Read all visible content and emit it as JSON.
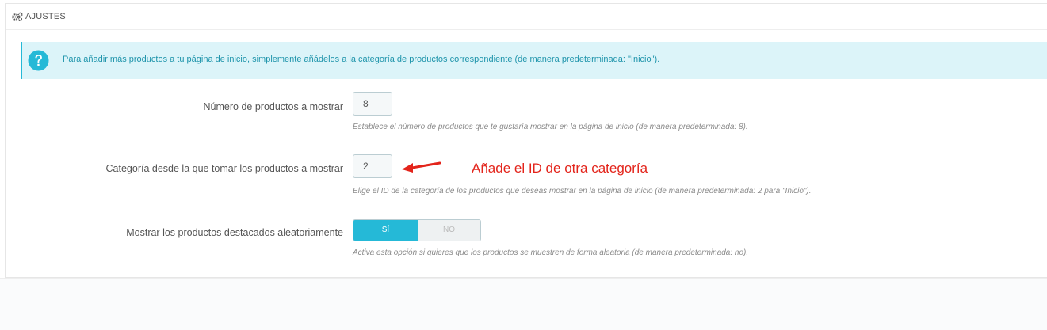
{
  "panel": {
    "title": "AJUSTES",
    "title_icon": "gears-icon"
  },
  "alert": {
    "icon": "question-circle-icon",
    "text": "Para añadir más productos a tu página de inicio, simplemente añádelos a la categoría de productos correspondiente (de manera predeterminada: \"Inicio\")."
  },
  "fields": {
    "num_products": {
      "label": "Número de productos a mostrar",
      "value": "8",
      "help": "Establece el número de productos que te gustaría mostrar en la página de inicio (de manera predeterminada: 8)."
    },
    "category": {
      "label": "Categoría desde la que tomar los productos a mostrar",
      "value": "2",
      "help": "Elige el ID de la categoría de los productos que deseas mostrar en la página de inicio (de manera predeterminada: 2 para \"Inicio\")."
    },
    "random": {
      "label": "Mostrar los productos destacados aleatoriamente",
      "yes_label": "SÍ",
      "no_label": "NO",
      "selected": "SÍ",
      "help": "Activa esta opción si quieres que los productos se muestren de forma aleatoria (de manera predeterminada: no)."
    }
  },
  "annotation": {
    "text": "Añade el ID de otra categoría",
    "color": "#e3241b"
  },
  "colors": {
    "accent": "#25b9d7",
    "alert_bg": "#dcf4f9",
    "alert_text": "#1e94ab"
  }
}
